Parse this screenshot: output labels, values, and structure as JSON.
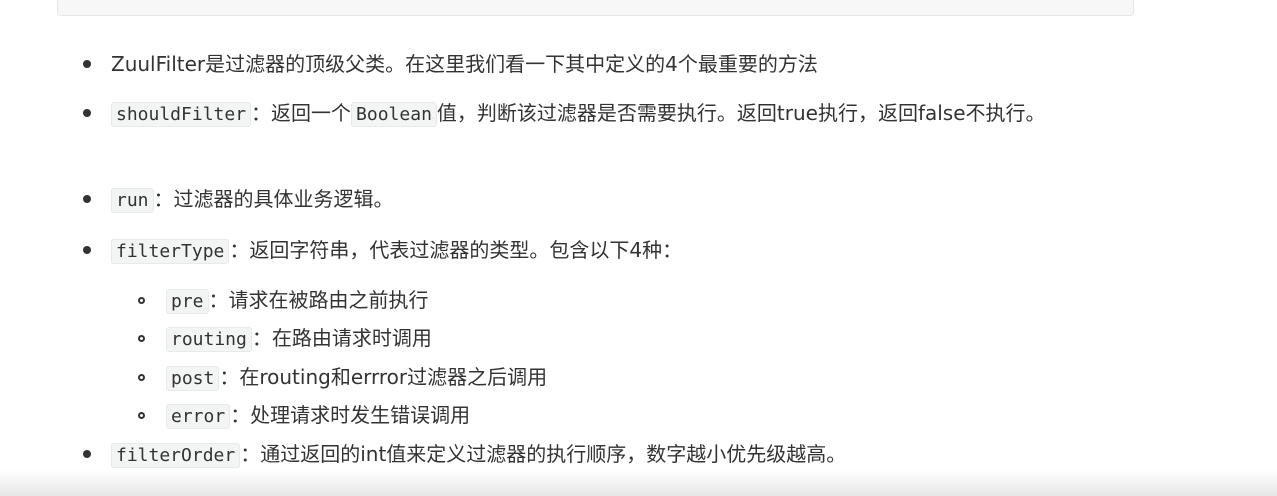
{
  "items": [
    {
      "text": "ZuulFilter是过滤器的顶级父类。在这里我们看一下其中定义的4个最重要的方法"
    },
    {
      "code": "shouldFilter",
      "text_a": "：返回一个",
      "code2": "Boolean",
      "text_b": "值，判断该过滤器是否需要执行。返回true执行，返回false不执行。"
    },
    {
      "code": "run",
      "text": "：过滤器的具体业务逻辑。"
    },
    {
      "code": "filterType",
      "text": "：返回字符串，代表过滤器的类型。包含以下4种："
    },
    {
      "code": "filterOrder",
      "text": "：通过返回的int值来定义过滤器的执行顺序，数字越小优先级越高。"
    }
  ],
  "sub_items": [
    {
      "code": "pre",
      "text": "：请求在被路由之前执行"
    },
    {
      "code": "routing",
      "text": "：在路由请求时调用"
    },
    {
      "code": "post",
      "text": "：在routing和errror过滤器之后调用"
    },
    {
      "code": "error",
      "text": "：处理请求时发生错误调用"
    }
  ]
}
